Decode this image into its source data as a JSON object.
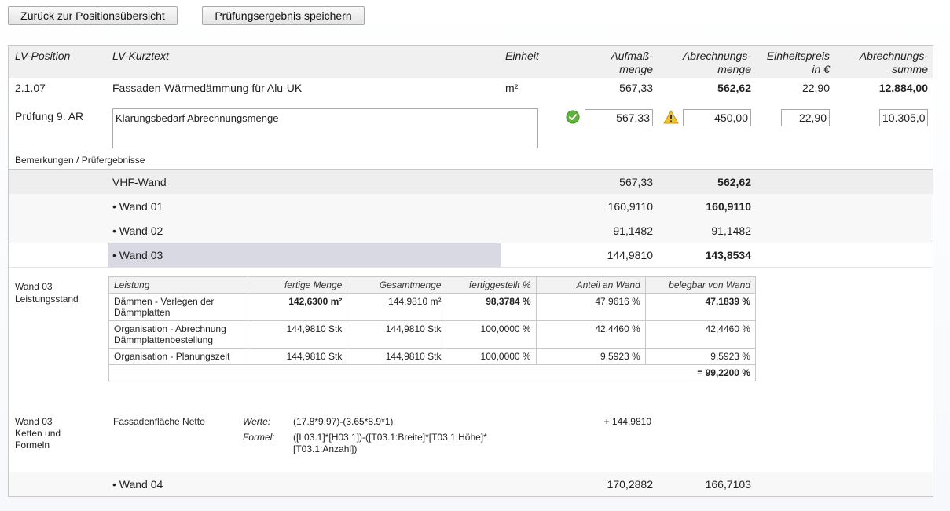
{
  "toolbar": {
    "back_label": "Zurück zur Positionsübersicht",
    "save_label": "Prüfungsergebnis speichern"
  },
  "header": {
    "col_pos": "LV-Position",
    "col_text": "LV-Kurztext",
    "col_unit": "Einheit",
    "col_aufmass_1": "Aufmaß-",
    "col_aufmass_2": "menge",
    "col_abr_1": "Abrechnungs-",
    "col_abr_2": "menge",
    "col_ep_1": "Einheitspreis",
    "col_ep_2": "in €",
    "col_sum_1": "Abrechnungs-",
    "col_sum_2": "summe"
  },
  "position": {
    "pos": "2.1.07",
    "text": "Fassaden-Wärmedämmung für Alu-UK",
    "unit": "m²",
    "aufmass": "567,33",
    "abrechnung": "562,62",
    "einheitspreis": "22,90",
    "summe": "12.884,00"
  },
  "pruefung": {
    "label": "Prüfung 9. AR",
    "remark": "Klärungsbedarf Abrechnungsmenge",
    "aufmass_value": "567,33",
    "abrechnung_value": "450,00",
    "ep_value": "22,90",
    "summe_value": "10.305,0",
    "remarks_caption": "Bemerkungen / Prüfergebnisse",
    "ok_icon": "check-circle-icon",
    "warn_icon": "warning-triangle-icon"
  },
  "group": {
    "name": "VHF-Wand",
    "aufmass": "567,33",
    "abrechnung": "562,62"
  },
  "walls": [
    {
      "name": "• Wand 01",
      "aufmass": "160,9110",
      "abrechnung": "160,9110"
    },
    {
      "name": "• Wand 02",
      "aufmass": "91,1482",
      "abrechnung": "91,1482"
    },
    {
      "name": "• Wand 03",
      "aufmass": "144,9810",
      "abrechnung": "143,8534"
    },
    {
      "name": "• Wand 04",
      "aufmass": "170,2882",
      "abrechnung": "166,7103"
    }
  ],
  "leistungsstand": {
    "label_1": "Wand 03",
    "label_2": "Leistungsstand",
    "columns": [
      "Leistung",
      "fertige Menge",
      "Gesamtmenge",
      "fertiggestellt %",
      "Anteil an Wand",
      "belegbar von Wand"
    ],
    "rows": [
      {
        "leistung_1": "Dämmen - Verlegen der",
        "leistung_2": "Dämmplatten",
        "fertig": "142,6300 m²",
        "gesamt": "144,9810 m²",
        "pct": "98,3784 %",
        "anteil": "47,9616 %",
        "belegbar": "47,1839 %"
      },
      {
        "leistung_1": "Organisation - Abrechnung",
        "leistung_2": "Dämmplattenbestellung",
        "fertig": "144,9810 Stk",
        "gesamt": "144,9810 Stk",
        "pct": "100,0000 %",
        "anteil": "42,4460 %",
        "belegbar": "42,4460 %"
      },
      {
        "leistung_1": "Organisation - Planungszeit",
        "leistung_2": "",
        "fertig": "144,9810 Stk",
        "gesamt": "144,9810 Stk",
        "pct": "100,0000 %",
        "anteil": "9,5923 %",
        "belegbar": "9,5923 %"
      }
    ],
    "total": "= 99,2200 %"
  },
  "formeln": {
    "label_1": "Wand 03",
    "label_2": "Ketten und",
    "label_3": "Formeln",
    "name": "Fassadenfläche Netto",
    "werte_label": "Werte:",
    "werte": "(17.8*9.97)-(3.65*8.9*1)",
    "formel_label": "Formel:",
    "formel_1": "([L03.1]*[H03.1])-([T03.1:Breite]*[T03.1:Höhe]*",
    "formel_2": "[T03.1:Anzahl])",
    "result": "+ 144,9810"
  }
}
